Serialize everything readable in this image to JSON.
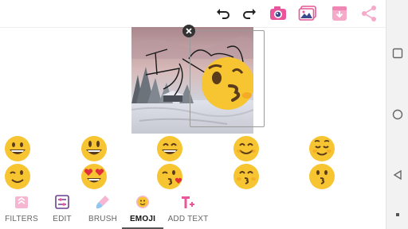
{
  "toolbar": {
    "icons": [
      "undo-icon",
      "redo-icon",
      "camera-icon",
      "gallery-icon",
      "save-download-icon",
      "share-icon"
    ]
  },
  "editor": {
    "handwriting_text": "Alok",
    "sticker": "kiss-face-emoji",
    "close_badge": "close-icon"
  },
  "emoji_picker": {
    "rows": [
      [
        "grinning-face",
        "smiley-face",
        "grinning-smiling-eyes",
        "smiling-face",
        "relaxed-face"
      ],
      [
        "winking-face",
        "heart-eyes-face",
        "blowing-kiss-face",
        "kissing-smiling-eyes",
        "kissing-face"
      ]
    ]
  },
  "bottom_nav": {
    "items": [
      {
        "label": "FILTERS",
        "icon": "filters-icon"
      },
      {
        "label": "EDIT",
        "icon": "sliders-icon"
      },
      {
        "label": "BRUSH",
        "icon": "brush-icon"
      },
      {
        "label": "EMOJI",
        "icon": "emoji-icon"
      },
      {
        "label": "ADD TEXT",
        "icon": "add-text-icon"
      }
    ],
    "active": "EMOJI"
  },
  "colors": {
    "accent_pink": "#e8559a",
    "emoji_yellow": "#f7c531",
    "emoji_orange": "#f39a1d",
    "active_underline": "#555555"
  },
  "system_nav": [
    "square-icon",
    "circle-icon",
    "back-triangle-icon",
    "dot-icon"
  ]
}
